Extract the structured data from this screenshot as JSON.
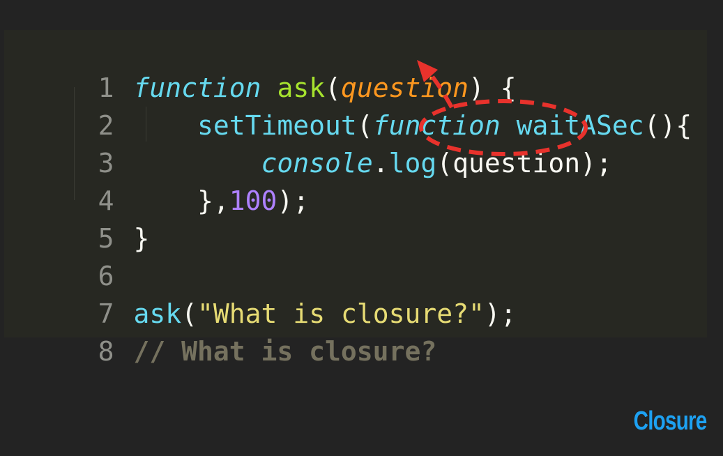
{
  "code": {
    "lines": [
      {
        "n": "1",
        "parts": [
          "function",
          " ",
          "ask",
          "(",
          "question",
          ") {"
        ]
      },
      {
        "n": "2",
        "parts": [
          "    ",
          "setTimeout",
          "(",
          "function",
          " ",
          "waitASec",
          "(){"
        ]
      },
      {
        "n": "3",
        "parts": [
          "        ",
          "console",
          ".",
          "log",
          "(question);"
        ]
      },
      {
        "n": "4",
        "parts": [
          "    },",
          "100",
          ");"
        ]
      },
      {
        "n": "5",
        "parts": [
          "}"
        ]
      },
      {
        "n": "6",
        "parts": [
          ""
        ]
      },
      {
        "n": "7",
        "parts": [
          "ask",
          "(",
          "\"What is closure?\"",
          ");"
        ]
      },
      {
        "n": "8",
        "parts": [
          "// What is closure?"
        ]
      }
    ]
  },
  "label": {
    "text": "Closure"
  },
  "colors": {
    "background": "#232323",
    "editor": "#272822",
    "annotation": "#e8322c",
    "label": "#1da1f2"
  }
}
